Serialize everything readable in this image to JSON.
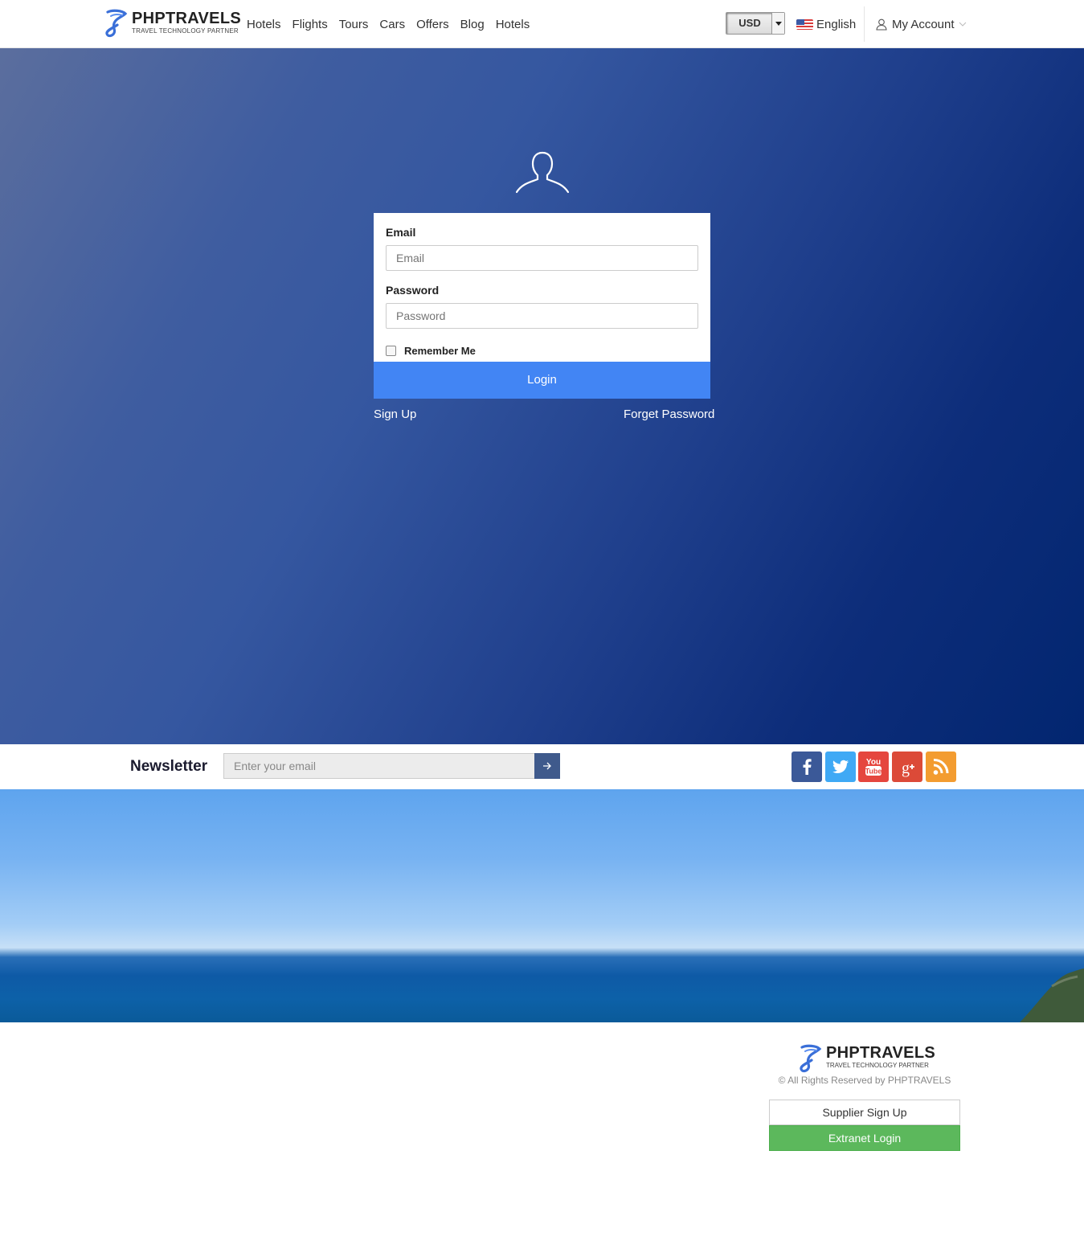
{
  "header": {
    "brand": "PHPTRAVELS",
    "brand_tagline": "TRAVEL TECHNOLOGY PARTNER",
    "nav": [
      "Hotels",
      "Flights",
      "Tours",
      "Cars",
      "Offers",
      "Blog",
      "Hotels"
    ],
    "currency": "USD",
    "language": "English",
    "account": "My Account"
  },
  "login": {
    "email_label": "Email",
    "email_placeholder": "Email",
    "password_label": "Password",
    "password_placeholder": "Password",
    "remember_label": "Remember Me",
    "login_button": "Login",
    "signup_link": "Sign Up",
    "forget_link": "Forget Password"
  },
  "newsletter": {
    "title": "Newsletter",
    "placeholder": "Enter your email",
    "submit_icon": "arrow-right-icon"
  },
  "social": [
    {
      "name": "facebook-icon",
      "color": "#3b5998"
    },
    {
      "name": "twitter-icon",
      "color": "#3fa9f5"
    },
    {
      "name": "youtube-icon",
      "color": "#e5463e"
    },
    {
      "name": "google-plus-icon",
      "color": "#dc4a38"
    },
    {
      "name": "rss-icon",
      "color": "#f39c30"
    }
  ],
  "footer": {
    "brand": "PHPTRAVELS",
    "brand_tagline": "TRAVEL TECHNOLOGY PARTNER",
    "copyright": "© All Rights Reserved by PHPTRAVELS",
    "supplier_signup": "Supplier Sign Up",
    "extranet_login": "Extranet Login"
  },
  "colors": {
    "primary_button": "#4285f4",
    "extranet_button": "#5cb85c",
    "hero_dark": "#022670"
  }
}
